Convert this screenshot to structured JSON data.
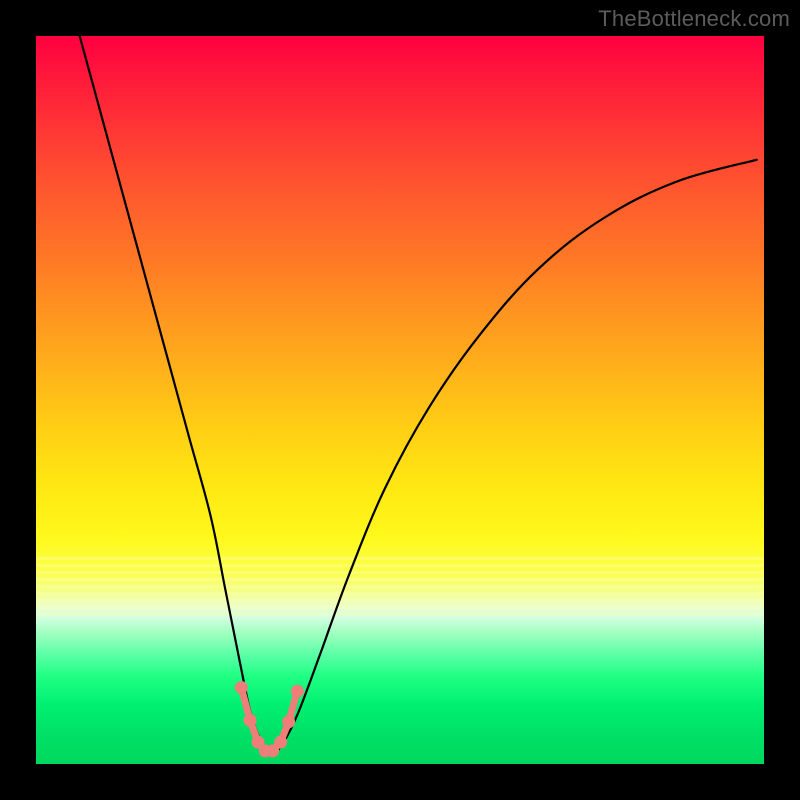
{
  "watermark": "TheBottleneck.com",
  "chart_data": {
    "type": "line",
    "title": "",
    "xlabel": "",
    "ylabel": "",
    "xlim": [
      0,
      100
    ],
    "ylim": [
      0,
      100
    ],
    "grid": false,
    "legend": false,
    "notes": "Bottleneck curve. Background vertical gradient red→orange→yellow→green encodes bottleneck severity (top=high bottleneck, bottom=low). Black V-shaped curve shows bottleneck % vs relative component balance. Small salmon-colored beaded segment near minimum highlights optimal range. No numeric axis ticks are visible.",
    "series": [
      {
        "name": "bottleneck-curve",
        "color": "#000000",
        "x": [
          6,
          9,
          12,
          15,
          18,
          21,
          24,
          26,
          28,
          29.5,
          31,
          32.5,
          34,
          36,
          39,
          43,
          48,
          54,
          61,
          69,
          78,
          88,
          99
        ],
        "y": [
          100,
          89,
          78,
          67,
          56,
          45,
          34,
          24,
          14,
          7,
          3,
          1.5,
          3,
          7,
          15,
          26,
          38,
          49,
          59,
          68,
          75,
          80,
          83
        ]
      },
      {
        "name": "optimal-range-markers",
        "color": "#ed7e79",
        "x": [
          28.2,
          29.4,
          30.5,
          31.5,
          32.5,
          33.6,
          34.7,
          35.9
        ],
        "y": [
          10.5,
          6.0,
          3.0,
          1.8,
          1.8,
          3.0,
          5.8,
          10.0
        ]
      }
    ],
    "background_gradient": {
      "orientation": "vertical",
      "stops": [
        {
          "pos": 0.0,
          "color": "#ff0040"
        },
        {
          "pos": 0.3,
          "color": "#ff7626"
        },
        {
          "pos": 0.55,
          "color": "#ffd714"
        },
        {
          "pos": 0.72,
          "color": "#feff30"
        },
        {
          "pos": 0.8,
          "color": "#d8ffc8"
        },
        {
          "pos": 1.0,
          "color": "#00dc62"
        }
      ]
    }
  }
}
